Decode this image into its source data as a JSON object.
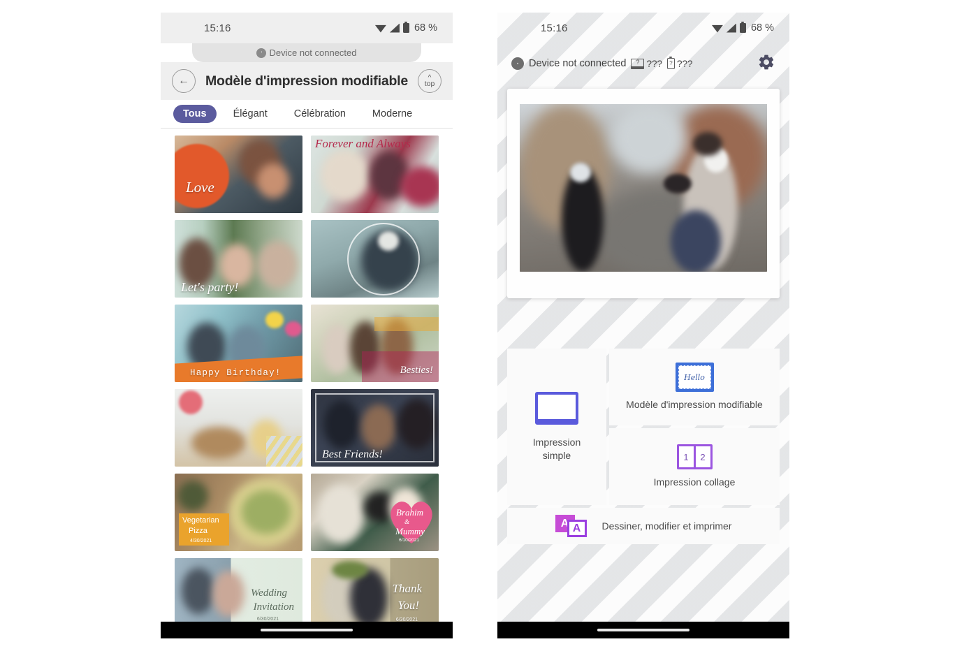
{
  "left_phone": {
    "statusbar": {
      "time": "15:16",
      "battery": "68 %",
      "wifi_icon": "wifi-icon",
      "signal_icon": "signal-icon",
      "battery_icon": "battery-icon"
    },
    "bluetooth_banner": {
      "icon": "bluetooth-icon",
      "text": "Device not connected"
    },
    "appbar": {
      "back_icon": "back-arrow-icon",
      "title": "Modèle d'impression modifiable",
      "top_button": {
        "caret": "⌃",
        "label": "top"
      }
    },
    "tabs": [
      {
        "label": "Tous",
        "active": true
      },
      {
        "label": "Élégant",
        "active": false
      },
      {
        "label": "Célébration",
        "active": false
      },
      {
        "label": "Moderne",
        "active": false
      }
    ],
    "templates": [
      {
        "id": "love",
        "caption": "Love"
      },
      {
        "id": "forever-and-always",
        "caption": "Forever and Always"
      },
      {
        "id": "lets-party",
        "caption": "Let's party!"
      },
      {
        "id": "winter-wreath",
        "caption": ""
      },
      {
        "id": "happy-birthday",
        "caption": "Happy Birthday!"
      },
      {
        "id": "besties",
        "caption": "Besties!"
      },
      {
        "id": "dog-and-girl",
        "caption": ""
      },
      {
        "id": "best-friends",
        "caption": "Best Friends!"
      },
      {
        "id": "vegetarian-pizza",
        "caption": "Vegetarian\nPizza",
        "caption_line1": "Vegetarian",
        "caption_line2": "Pizza",
        "date": "4/30/2021"
      },
      {
        "id": "brahim-and-mummy",
        "caption_line1": "Brahim",
        "caption_amp": "&",
        "caption_line2": "Mummy",
        "date": "6/10/2021"
      },
      {
        "id": "wedding-invitation",
        "caption_line1": "Wedding",
        "caption_line2": "Invitation",
        "date": "6/30/2021"
      },
      {
        "id": "thank-you",
        "caption_line1": "Thank",
        "caption_line2": "You!",
        "date": "6/30/2021"
      }
    ],
    "navbar": {
      "home_indicator": "home-indicator"
    }
  },
  "right_phone": {
    "statusbar": {
      "time": "15:16",
      "battery": "68 %"
    },
    "header": {
      "bluetooth_icon": "bluetooth-icon",
      "bluetooth_text": "Device not connected",
      "printer_status": {
        "icon_glyph": "?",
        "value": "???"
      },
      "battery_status": {
        "icon_glyph": "?",
        "value": "???"
      },
      "settings_icon": "gear-icon"
    },
    "preview": {
      "photo_alt": "street-photo-preview"
    },
    "menu": {
      "simple": {
        "icon": "simple-print-icon",
        "label_line1": "Impression",
        "label_line2": "simple"
      },
      "template": {
        "icon": "hello-template-icon",
        "icon_text": "Hello",
        "label": "Modèle d'impression modifiable"
      },
      "collage": {
        "icon": "collage-icon",
        "cell1": "1",
        "cell2": "2",
        "label": "Impression collage"
      },
      "draw": {
        "icon": "draw-edit-print-icon",
        "letter1": "A",
        "letter2": "A",
        "label": "Dessiner, modifier et imprimer"
      }
    },
    "navbar": {
      "home_indicator": "home-indicator"
    }
  },
  "colors": {
    "accent_tab": "#5b5b9e",
    "simple_icon": "#5a5adc",
    "template_icon": "#3d6fd8",
    "collage_icon": "#9b55e0",
    "draw_icon": "#c64cd6"
  }
}
